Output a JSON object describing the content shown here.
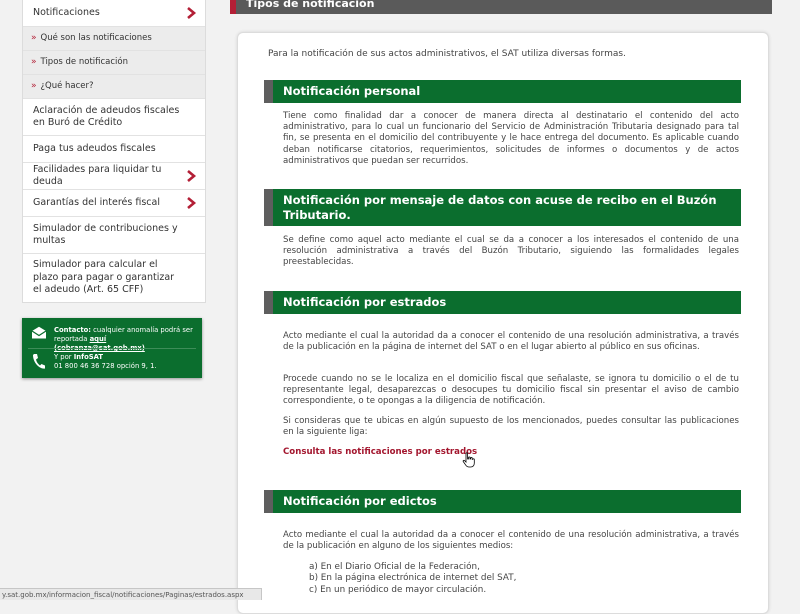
{
  "sidebar": {
    "items": [
      {
        "label": "Notificaciones",
        "has_chevron": true
      },
      {
        "label": "Qué son las notificaciones",
        "sub": true
      },
      {
        "label": "Tipos de notificación",
        "sub": true
      },
      {
        "label": "¿Qué hacer?",
        "sub": true
      },
      {
        "label": "Aclaración de adeudos fiscales en Buró de Crédito"
      },
      {
        "label": "Paga tus adeudos fiscales"
      },
      {
        "label": "Facilidades para liquidar tu deuda",
        "has_chevron": true
      },
      {
        "label": "Garantías del interés fiscal",
        "has_chevron": true
      },
      {
        "label": "Simulador de contribuciones y multas"
      },
      {
        "label": "Simulador para calcular el plazo para pagar o garantizar el adeudo (Art. 65 CFF)"
      }
    ]
  },
  "contact": {
    "label": "Contacto:",
    "text": "cualquier anomalía podrá ser reportada",
    "link_word": "aquí",
    "email": "(cobranza@sat.gob.mx)",
    "phone_prefix": "Y por",
    "phone_brand": "InfoSAT",
    "phone": "01 800 46 36 728 opción 9, 1.",
    "icons": [
      "mail-icon",
      "phone-icon"
    ]
  },
  "page": {
    "title": "Tipos de notificación",
    "intro": "Para la notificación de sus actos administrativos, el SAT utiliza diversas formas."
  },
  "sections": [
    {
      "heading": "Notificación personal",
      "paragraphs": [
        "Tiene como finalidad dar a conocer de manera directa al destinatario el contenido del acto administrativo, para lo cual un funcionario del Servicio de Administración Tributaria designado para tal fin, se presenta en el domicilio del contribuyente y le hace entrega del documento. Es aplicable cuando deban notificarse citatorios, requerimientos, solicitudes de informes o documentos y de actos administrativos que puedan ser recurridos."
      ]
    },
    {
      "heading": "Notificación por mensaje de datos con acuse de recibo en el Buzón Tributario.",
      "paragraphs": [
        "Se define como aquel acto mediante el cual se da a conocer a los interesados el contenido de una resolución administrativa a través del Buzón Tributario, siguiendo las formalidades legales preestablecidas."
      ]
    },
    {
      "heading": "Notificación por estrados",
      "paragraphs": [
        "Acto mediante el cual la autoridad da a conocer el contenido de una resolución administrativa, a través de la publicación en la página de internet del SAT o en el lugar abierto al público en sus oficinas.",
        "Procede cuando no se le localiza en el domicilio fiscal que señalaste, se ignora tu domicilio o el de tu representante legal, desaparezcas o desocupes tu domicilio fiscal sin presentar el aviso de cambio correspondiente, o te opongas a la diligencia de notificación.",
        "Si consideras que te ubicas en algún supuesto de los mencionados, puedes consultar las publicaciones en la siguiente liga:"
      ],
      "link": "Consulta las notificaciones por estrados"
    },
    {
      "heading": "Notificación por edictos",
      "paragraphs": [
        "Acto mediante el cual la autoridad da a conocer el contenido de una resolución administrativa, a través de la publicación en alguno de los siguientes medios:"
      ],
      "list": [
        "a) En el Diario Oficial de la Federación,",
        "b) En la página electrónica de internet del SAT,",
        "c) En un periódico de mayor circulación."
      ]
    }
  ],
  "status_bar": "y.sat.gob.mx/informacion_fiscal/notificaciones/Paginas/estrados.aspx",
  "colors": {
    "green": "#0b6e2e",
    "red": "#b31f36",
    "gray": "#5a5a5a"
  }
}
